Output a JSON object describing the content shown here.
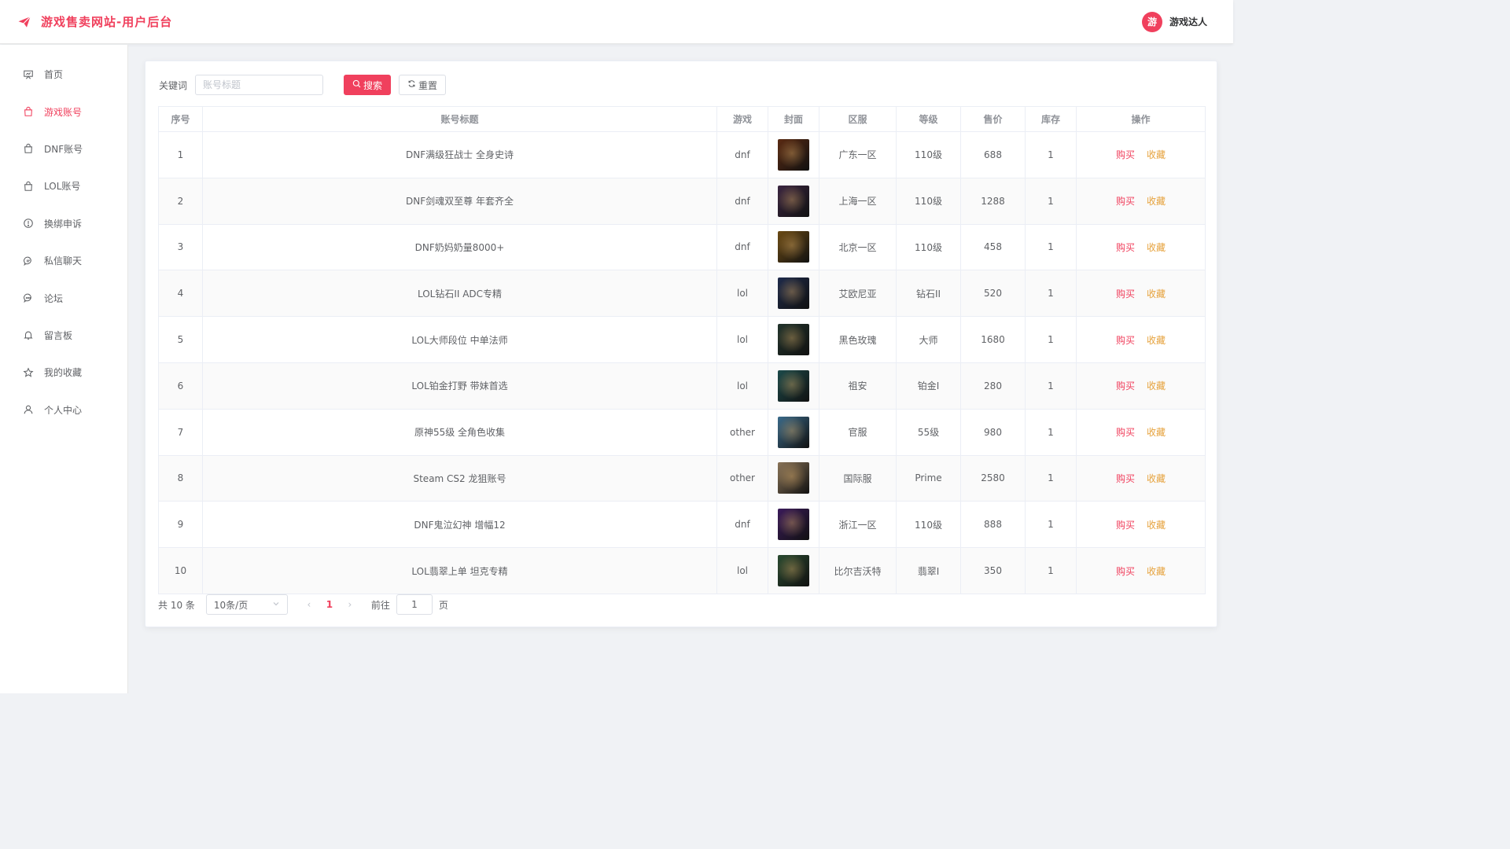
{
  "header": {
    "title": "游戏售卖网站-用户后台",
    "avatar_char": "游",
    "user_name": "游戏达人",
    "brand_color": "#f0405d"
  },
  "sidebar": {
    "items": [
      {
        "label": "首页",
        "icon": "presentation-icon",
        "active": false
      },
      {
        "label": "游戏账号",
        "icon": "shopping-bag-icon",
        "active": true
      },
      {
        "label": "DNF账号",
        "icon": "shopping-bag-icon",
        "active": false
      },
      {
        "label": "LOL账号",
        "icon": "shopping-bag-icon",
        "active": false
      },
      {
        "label": "换绑申诉",
        "icon": "warning-circle-icon",
        "active": false
      },
      {
        "label": "私信聊天",
        "icon": "chat-icon",
        "active": false
      },
      {
        "label": "论坛",
        "icon": "chat-dots-icon",
        "active": false
      },
      {
        "label": "留言板",
        "icon": "bell-icon",
        "active": false
      },
      {
        "label": "我的收藏",
        "icon": "star-icon",
        "active": false
      },
      {
        "label": "个人中心",
        "icon": "user-icon",
        "active": false
      }
    ]
  },
  "search": {
    "label": "关键词",
    "placeholder": "账号标题",
    "value": "",
    "search_label": "搜索",
    "reset_label": "重置"
  },
  "table": {
    "columns": [
      "序号",
      "账号标题",
      "游戏",
      "封面",
      "区服",
      "等级",
      "售价",
      "库存",
      "操作"
    ],
    "buy_label": "购买",
    "fav_label": "收藏",
    "rows": [
      {
        "no": "1",
        "title": "DNF满级狂战士 全身史诗",
        "game": "dnf",
        "server": "广东一区",
        "level": "110级",
        "price": "688",
        "stock": "1",
        "cover": "#5a2a12"
      },
      {
        "no": "2",
        "title": "DNF剑魂双至尊 年套齐全",
        "game": "dnf",
        "server": "上海一区",
        "level": "110级",
        "price": "1288",
        "stock": "1",
        "cover": "#3a2540"
      },
      {
        "no": "3",
        "title": "DNF奶妈奶量8000+",
        "game": "dnf",
        "server": "北京一区",
        "level": "110级",
        "price": "458",
        "stock": "1",
        "cover": "#6b4a14"
      },
      {
        "no": "4",
        "title": "LOL钻石II ADC专精",
        "game": "lol",
        "server": "艾欧尼亚",
        "level": "钻石II",
        "price": "520",
        "stock": "1",
        "cover": "#1e2a4a"
      },
      {
        "no": "5",
        "title": "LOL大师段位 中单法师",
        "game": "lol",
        "server": "黑色玫瑰",
        "level": "大师",
        "price": "1680",
        "stock": "1",
        "cover": "#22342c"
      },
      {
        "no": "6",
        "title": "LOL铂金打野 带妹首选",
        "game": "lol",
        "server": "祖安",
        "level": "铂金I",
        "price": "280",
        "stock": "1",
        "cover": "#1c4a4a"
      },
      {
        "no": "7",
        "title": "原神55级 全角色收集",
        "game": "other",
        "server": "官服",
        "level": "55级",
        "price": "980",
        "stock": "1",
        "cover": "#3a6a8a"
      },
      {
        "no": "8",
        "title": "Steam CS2 龙狙账号",
        "game": "other",
        "server": "国际服",
        "level": "Prime",
        "price": "2580",
        "stock": "1",
        "cover": "#8a7458"
      },
      {
        "no": "9",
        "title": "DNF鬼泣幻神 增幅12",
        "game": "dnf",
        "server": "浙江一区",
        "level": "110级",
        "price": "888",
        "stock": "1",
        "cover": "#3a1a5a"
      },
      {
        "no": "10",
        "title": "LOL翡翠上单 坦克专精",
        "game": "lol",
        "server": "比尔吉沃特",
        "level": "翡翠I",
        "price": "350",
        "stock": "1",
        "cover": "#2a4a30"
      }
    ]
  },
  "pagination": {
    "total_text": "共 10 条",
    "page_size": "10条/页",
    "current_page": "1",
    "goto_label": "前往",
    "goto_value": "1",
    "page_suffix": "页"
  }
}
